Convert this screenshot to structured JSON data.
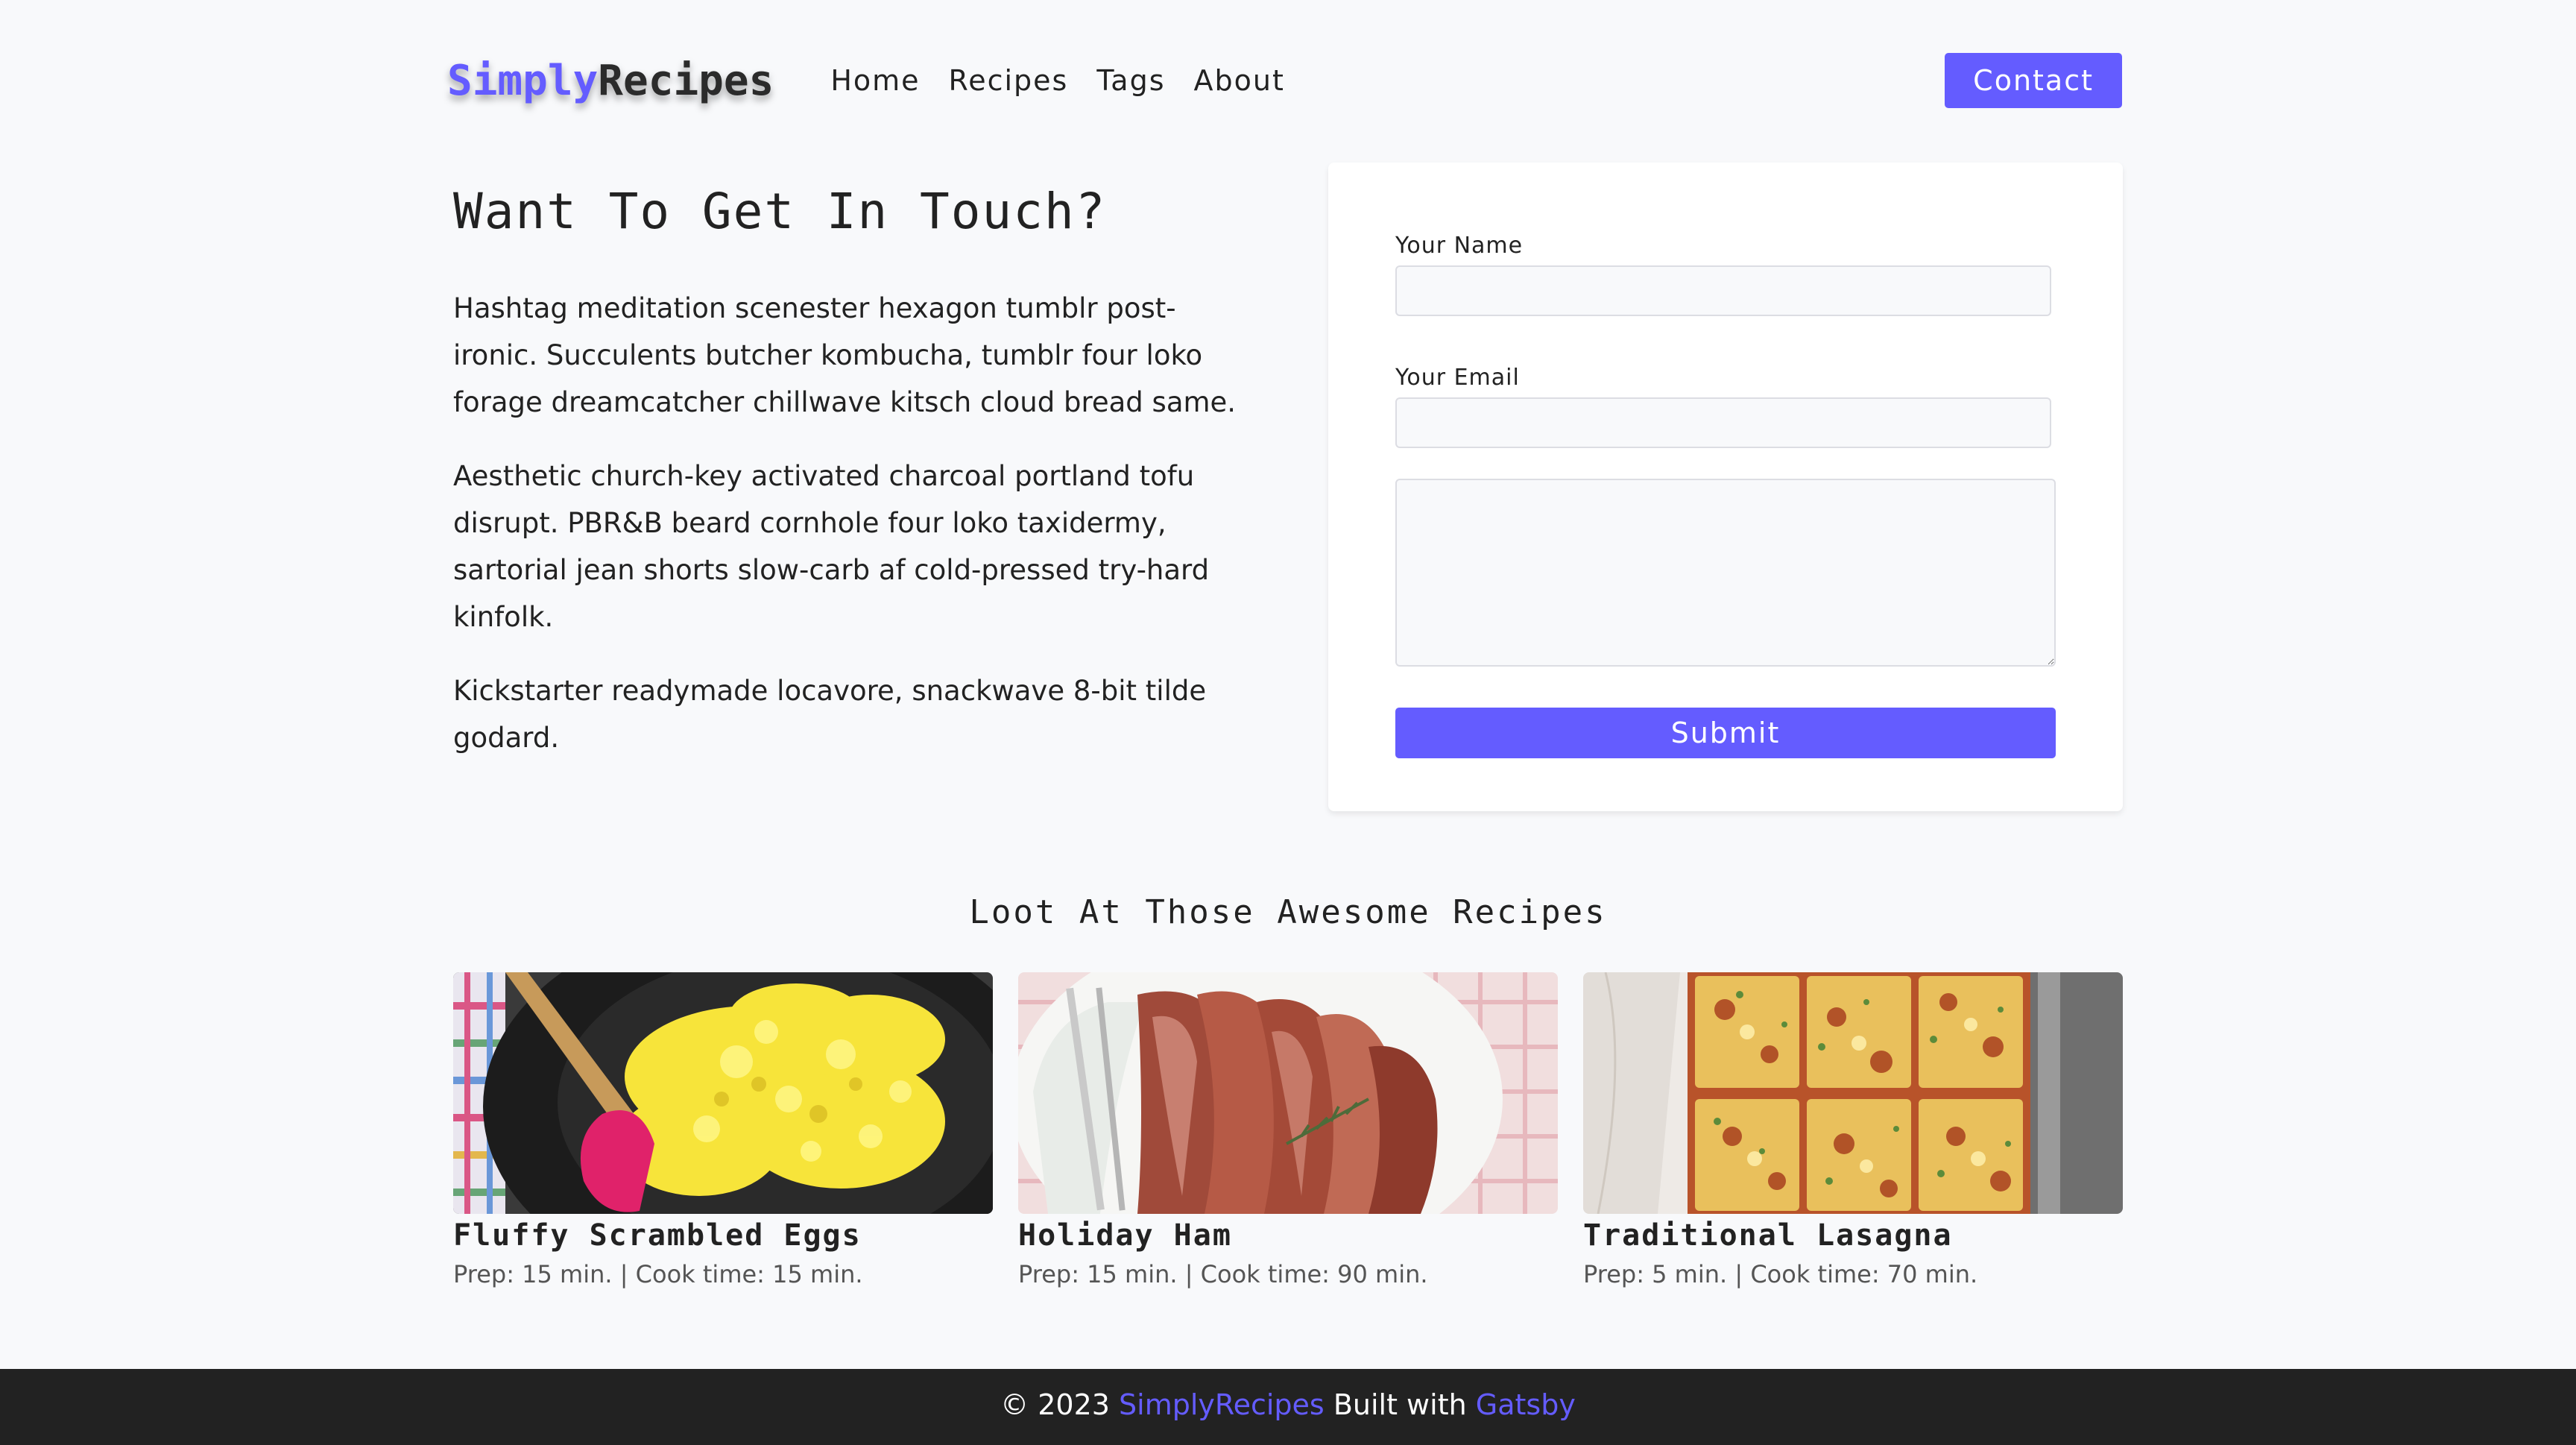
{
  "colors": {
    "accent": "#645cff",
    "background": "#f8f9fb",
    "footer_bg": "#222222"
  },
  "nav": {
    "logo_part1": "Simply",
    "logo_part2": "Recipes",
    "links": [
      "Home",
      "Recipes",
      "Tags",
      "About"
    ],
    "contact_label": "Contact"
  },
  "intro": {
    "title": "Want To Get In Touch?",
    "paragraphs": [
      "Hashtag meditation scenester hexagon tumblr post-ironic. Succulents butcher kombucha, tumblr four loko forage dreamcatcher chillwave kitsch cloud bread same.",
      "Aesthetic church-key activated charcoal portland tofu disrupt. PBR&B beard cornhole four loko taxidermy, sartorial jean shorts slow-carb af cold-pressed try-hard kinfolk.",
      "Kickstarter readymade locavore, snackwave 8-bit tilde godard."
    ]
  },
  "form": {
    "name_label": "Your Name",
    "name_value": "",
    "email_label": "Your Email",
    "email_value": "",
    "message_value": "",
    "submit_label": "Submit"
  },
  "recipes_section": {
    "title": "Loot At Those Awesome Recipes",
    "items": [
      {
        "title": "Fluffy Scrambled Eggs",
        "meta": "Prep: 15 min. | Cook time: 15 min.",
        "image": "scrambled-eggs-photo"
      },
      {
        "title": "Holiday Ham",
        "meta": "Prep: 15 min. | Cook time: 90 min.",
        "image": "holiday-ham-photo"
      },
      {
        "title": "Traditional Lasagna",
        "meta": "Prep: 5 min. | Cook time: 70 min.",
        "image": "lasagna-photo"
      }
    ]
  },
  "footer": {
    "prefix": "© 2023 ",
    "brand": "SimplyRecipes",
    "middle": " Built with ",
    "framework": "Gatsby"
  }
}
